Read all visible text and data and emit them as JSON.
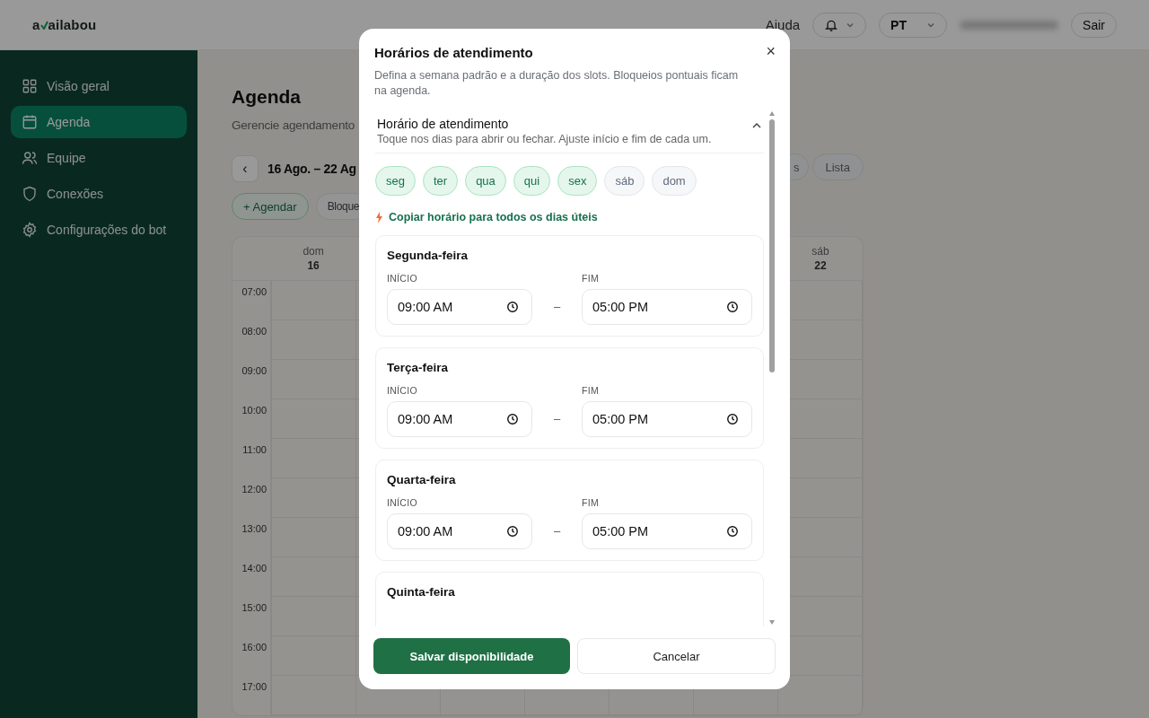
{
  "header": {
    "logo_start": "a",
    "logo_end": "ailabou",
    "help": "Ajuda",
    "language": "PT",
    "logout": "Sair"
  },
  "sidebar": {
    "items": [
      {
        "label": "Visão geral",
        "selected": false
      },
      {
        "label": "Agenda",
        "selected": true
      },
      {
        "label": "Equipe",
        "selected": false
      },
      {
        "label": "Conexões",
        "selected": false
      },
      {
        "label": "Configurações do bot",
        "selected": false
      }
    ]
  },
  "page": {
    "title": "Agenda",
    "subtitle": "Gerencie agendamento",
    "prev": "‹",
    "range": "16 Ago. – 22 Ag",
    "add": "+ Agendar",
    "block": "Bloque",
    "view_cut": "s",
    "view_list": "Lista"
  },
  "calendar": {
    "first_day": {
      "day": "dom",
      "date": "16"
    },
    "last_day": {
      "day": "sáb",
      "date": "22"
    },
    "times": [
      "07:00",
      "08:00",
      "09:00",
      "10:00",
      "11:00",
      "12:00",
      "13:00",
      "14:00",
      "15:00",
      "16:00",
      "17:00"
    ]
  },
  "dialog": {
    "title": "Horários de atendimento",
    "description": "Defina a semana padrão e a duração dos slots. Bloqueios pontuais ficam na agenda.",
    "close": "×",
    "section": {
      "title": "Horário de atendimento",
      "hint": "Toque nos dias para abrir ou fechar. Ajuste início e fim de cada um.",
      "expanded": true
    },
    "days": [
      {
        "label": "seg",
        "selected": true
      },
      {
        "label": "ter",
        "selected": true
      },
      {
        "label": "qua",
        "selected": true
      },
      {
        "label": "qui",
        "selected": true
      },
      {
        "label": "sex",
        "selected": true
      },
      {
        "label": "sáb",
        "selected": false
      },
      {
        "label": "dom",
        "selected": false
      }
    ],
    "copy_link": "Copiar horário para todos os dias úteis",
    "schedules": [
      {
        "day": "Segunda-feira",
        "start_label": "INÍCIO",
        "start": "09:00 AM",
        "separator": "–",
        "end_label": "FIM",
        "end": "05:00 PM"
      },
      {
        "day": "Terça-feira",
        "start_label": "INÍCIO",
        "start": "09:00 AM",
        "separator": "–",
        "end_label": "FIM",
        "end": "05:00 PM"
      },
      {
        "day": "Quarta-feira",
        "start_label": "INÍCIO",
        "start": "09:00 AM",
        "separator": "–",
        "end_label": "FIM",
        "end": "05:00 PM"
      },
      {
        "day": "Quinta-feira"
      }
    ],
    "save": "Salvar disponibilidade",
    "cancel": "Cancelar"
  }
}
